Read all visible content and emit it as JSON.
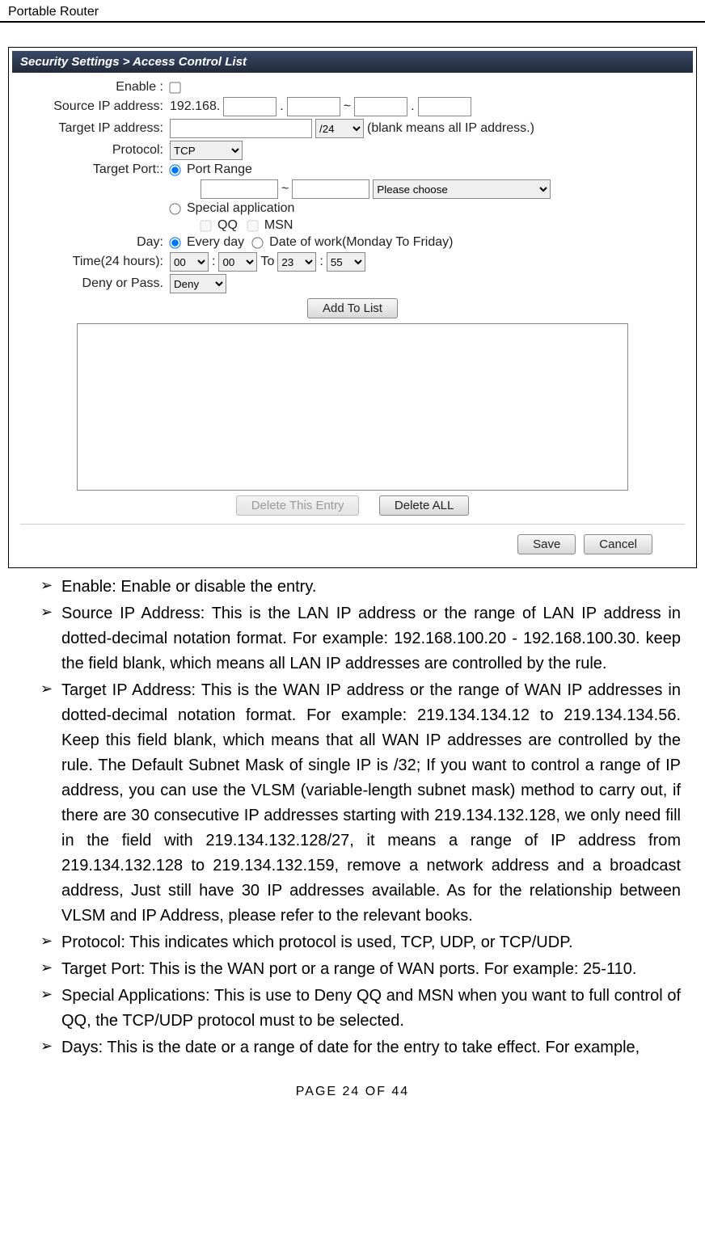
{
  "header": {
    "title": "Portable Router"
  },
  "screenshot": {
    "titlebar": "Security Settings > Access Control List",
    "labels": {
      "enable": "Enable :",
      "sourceip": "Source IP address:",
      "targetip": "Target IP address:",
      "protocol": "Protocol:",
      "targetport": "Target Port::",
      "day": "Day:",
      "time": "Time(24 hours):",
      "denypass": "Deny or Pass."
    },
    "source_prefix": "192.168.",
    "cidr_value": "/24",
    "target_note": "(blank means all IP address.)",
    "protocol_value": "TCP",
    "port_range_label": "Port Range",
    "please_choose": "Please choose",
    "special_app_label": "Special application",
    "qq_label": "QQ",
    "msn_label": "MSN",
    "every_day_label": "Every day",
    "date_of_work_label": "Date of work(Monday To Friday)",
    "time_h1": "00",
    "time_m1": "00",
    "time_to": "To",
    "time_h2": "23",
    "time_m2": "55",
    "deny_value": "Deny",
    "buttons": {
      "add": "Add To List",
      "delete_entry": "Delete This Entry",
      "delete_all": "Delete ALL",
      "save": "Save",
      "cancel": "Cancel"
    }
  },
  "bullets": {
    "b1": "Enable: Enable or disable the entry.",
    "b2": "Source IP Address: This is the LAN IP address or the range of LAN IP address in dotted-decimal notation format. For example: 192.168.100.20 - 192.168.100.30. keep the field blank, which means all LAN IP addresses are controlled by the rule.",
    "b3": "Target IP Address: This is the WAN IP address or the range of WAN IP addresses in dotted-decimal notation format. For example: 219.134.134.12 to 219.134.134.56. Keep this field blank, which means that all WAN IP addresses are controlled by the rule. The Default Subnet Mask of single IP is /32; If you want to control a range of IP address, you can use the VLSM (variable-length subnet mask) method to carry out, if there are 30 consecutive IP addresses starting with 219.134.132.128, we only need fill in the field with 219.134.132.128/27, it means a range of IP address from 219.134.132.128 to 219.134.132.159, remove a network address and a broadcast address, Just still have 30 IP addresses available. As for the relationship between VLSM and IP Address, please refer to the relevant books.",
    "b4": "Protocol: This indicates which protocol is used, TCP, UDP, or TCP/UDP.",
    "b5": "Target Port: This is the WAN port or a range of WAN ports. For example: 25-110.",
    "b6": "Special Applications: This is use to Deny QQ and MSN when you want to full control of QQ, the TCP/UDP protocol must to be selected.",
    "b7": "Days: This is the date or a range of date for the entry to take effect. For example,"
  },
  "footer": "PAGE    24    OF    44"
}
